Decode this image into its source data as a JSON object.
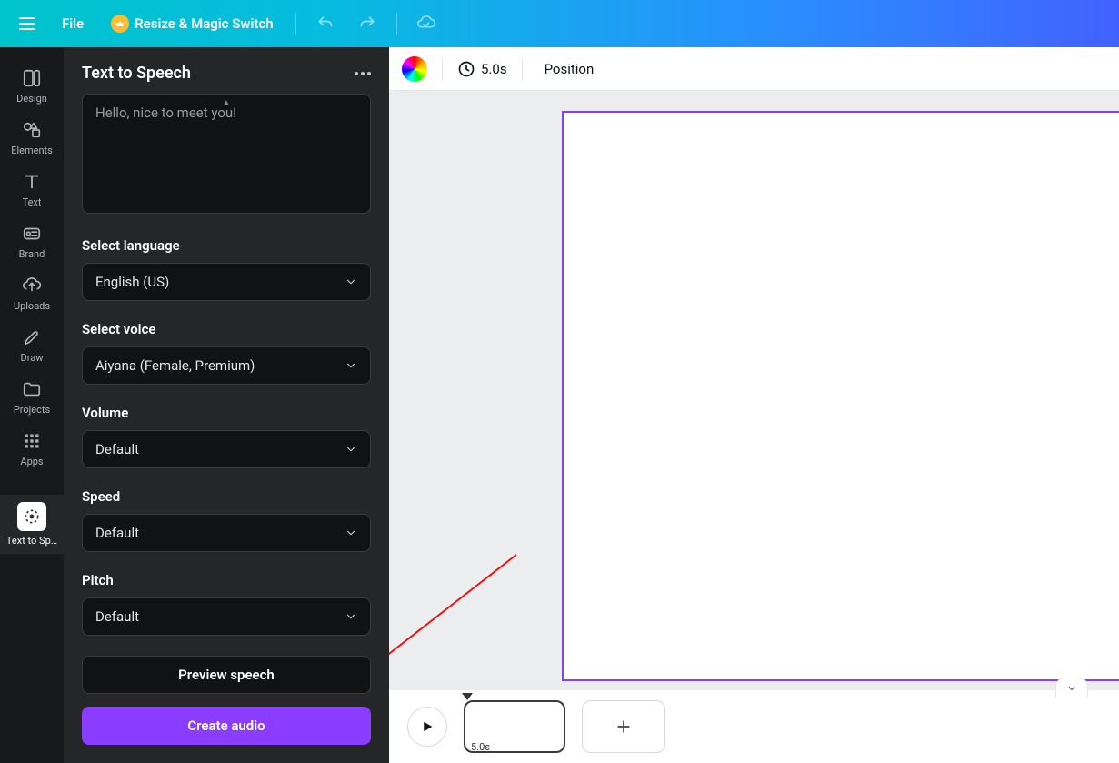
{
  "header": {
    "file_label": "File",
    "resize_label": "Resize & Magic Switch"
  },
  "sidebar": {
    "items": [
      {
        "label": "Design"
      },
      {
        "label": "Elements"
      },
      {
        "label": "Text"
      },
      {
        "label": "Brand"
      },
      {
        "label": "Uploads"
      },
      {
        "label": "Draw"
      },
      {
        "label": "Projects"
      },
      {
        "label": "Apps"
      },
      {
        "label": "Text to Sp…"
      }
    ]
  },
  "panel": {
    "title": "Text to Speech",
    "text_input": "Hello, nice to meet you!",
    "fields": {
      "language": {
        "label": "Select language",
        "value": "English (US)"
      },
      "voice": {
        "label": "Select voice",
        "value": "Aiyana (Female, Premium)"
      },
      "volume": {
        "label": "Volume",
        "value": "Default"
      },
      "speed": {
        "label": "Speed",
        "value": "Default"
      },
      "pitch": {
        "label": "Pitch",
        "value": "Default"
      }
    },
    "preview_label": "Preview speech",
    "create_label": "Create audio"
  },
  "context_toolbar": {
    "duration": "5.0s",
    "position_label": "Position"
  },
  "timeline": {
    "thumb_duration": "5.0s"
  },
  "colors": {
    "accent": "#8b3dff"
  }
}
